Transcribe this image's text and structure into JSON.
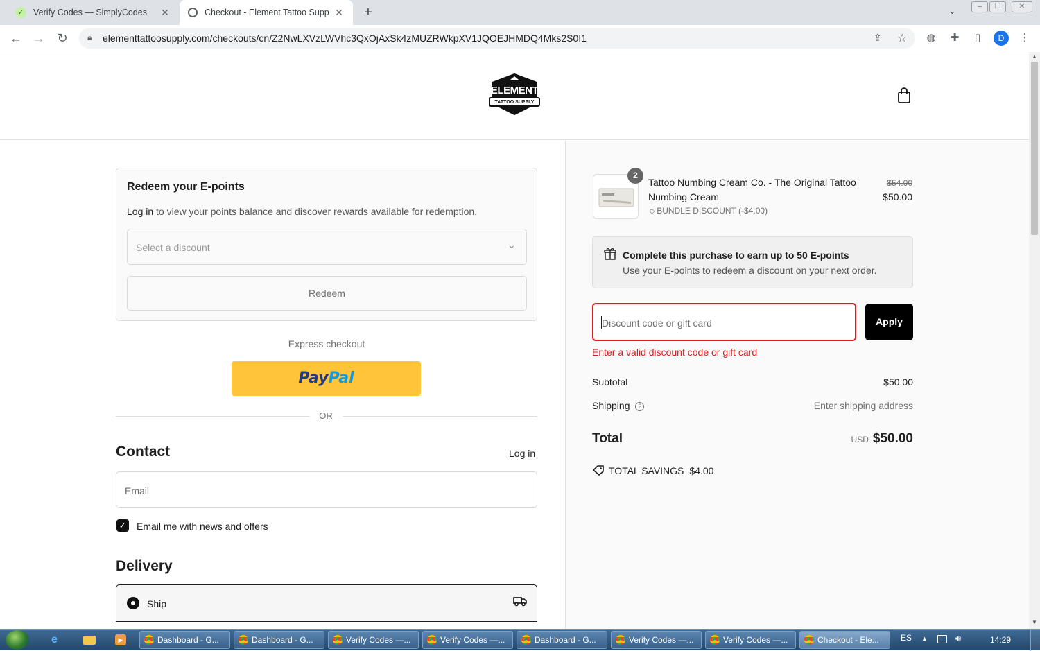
{
  "browser": {
    "tabs": [
      {
        "title": "Verify Codes — SimplyCodes",
        "active": false
      },
      {
        "title": "Checkout - Element Tattoo Supp",
        "active": true
      }
    ],
    "url": "elementtattoosupply.com/checkouts/cn/Z2NwLXVzLWVhc3QxOjAxSk4zMUZRWkpXV1JQOEJHMDQ4Mks2S0I1",
    "profile_initial": "D"
  },
  "header": {
    "logo_text": "ELEMENT",
    "logo_subtext": "TATTOO SUPPLY"
  },
  "epoints": {
    "title": "Redeem your E-points",
    "login_link": "Log in",
    "description": " to view your points balance and discover rewards available for redemption.",
    "select_placeholder": "Select a discount",
    "redeem_label": "Redeem"
  },
  "express": {
    "label": "Express checkout",
    "paypal_pay": "Pay",
    "paypal_pal": "Pal",
    "or_label": "OR"
  },
  "contact": {
    "title": "Contact",
    "login_link": "Log in",
    "email_placeholder": "Email",
    "newsletter_label": "Email me with news and offers",
    "newsletter_checked": true
  },
  "delivery": {
    "title": "Delivery",
    "ship_label": "Ship"
  },
  "order": {
    "item": {
      "quantity": "2",
      "name": "Tattoo Numbing Cream Co. - The Original Tattoo Numbing Cream",
      "discount_label": "BUNDLE DISCOUNT (-$4.00)",
      "original_price": "$54.00",
      "price": "$50.00"
    },
    "rewards": {
      "title": "Complete this purchase to earn up to 50 E-points",
      "subtitle": "Use your E-points to redeem a discount on your next order."
    },
    "discount": {
      "placeholder": "Discount code or gift card",
      "apply_label": "Apply",
      "error": "Enter a valid discount code or gift card"
    },
    "subtotal_label": "Subtotal",
    "subtotal_value": "$50.00",
    "shipping_label": "Shipping",
    "shipping_value": "Enter shipping address",
    "total_label": "Total",
    "currency": "USD",
    "total_value": "$50.00",
    "savings_label": "TOTAL SAVINGS",
    "savings_value": "$4.00"
  },
  "taskbar": {
    "items": [
      "Dashboard - G...",
      "Dashboard - G...",
      "Verify Codes —...",
      "Verify Codes —...",
      "Dashboard - G...",
      "Verify Codes —...",
      "Verify Codes —...",
      "Checkout - Ele..."
    ],
    "language": "ES",
    "clock": "14:29"
  },
  "colors": {
    "error": "#dd1d1d",
    "button_dark": "#000000",
    "paypal_yellow": "#ffc439",
    "paypal_dark_blue": "#253b80",
    "paypal_light_blue": "#179bd7"
  }
}
